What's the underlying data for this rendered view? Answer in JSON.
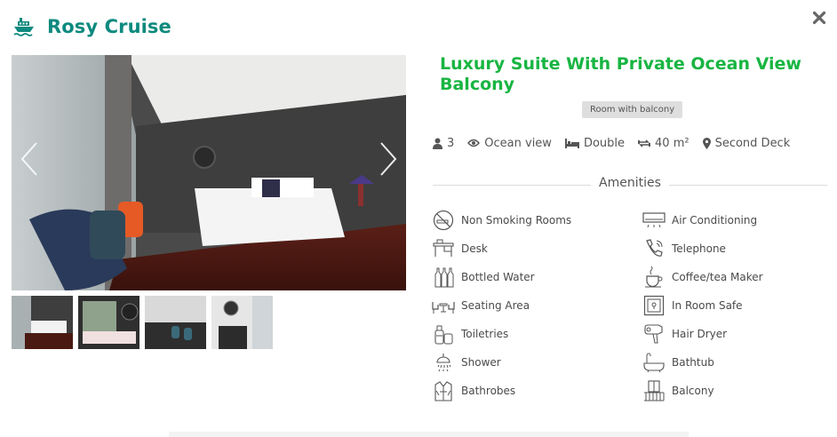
{
  "header": {
    "title": "Rosy Cruise",
    "logo_icon": "ship-icon"
  },
  "colors": {
    "brand": "#0d8a7e",
    "title": "#18b541",
    "text": "#4a4a4a"
  },
  "gallery": {
    "prev_icon": "chevron-left-icon",
    "next_icon": "chevron-right-icon",
    "thumbnails": [
      "thumb-1",
      "thumb-2",
      "thumb-3",
      "thumb-4"
    ]
  },
  "room": {
    "title": "Luxury Suite With Private Ocean View Balcony",
    "badge": "Room with balcony",
    "specs": [
      {
        "icon": "user-icon",
        "label": "3"
      },
      {
        "icon": "eye-icon",
        "label": "Ocean view"
      },
      {
        "icon": "bed-icon",
        "label": "Double"
      },
      {
        "icon": "area-icon",
        "label": "40 m²"
      },
      {
        "icon": "map-marker-icon",
        "label": "Second Deck"
      }
    ]
  },
  "amenities": {
    "title": "Amenities",
    "items": [
      {
        "label": "Non Smoking Rooms",
        "icon": "no-smoking-icon"
      },
      {
        "label": "Air Conditioning",
        "icon": "air-conditioner-icon"
      },
      {
        "label": "Desk",
        "icon": "desk-icon"
      },
      {
        "label": "Telephone",
        "icon": "telephone-icon"
      },
      {
        "label": "Bottled Water",
        "icon": "bottled-water-icon"
      },
      {
        "label": "Coffee/tea Maker",
        "icon": "coffee-maker-icon"
      },
      {
        "label": "Seating Area",
        "icon": "seating-area-icon"
      },
      {
        "label": "In Room Safe",
        "icon": "safe-icon"
      },
      {
        "label": "Toiletries",
        "icon": "toiletries-icon"
      },
      {
        "label": "Hair Dryer",
        "icon": "hair-dryer-icon"
      },
      {
        "label": "Shower",
        "icon": "shower-icon"
      },
      {
        "label": "Bathtub",
        "icon": "bathtub-icon"
      },
      {
        "label": "Bathrobes",
        "icon": "bathrobe-icon"
      },
      {
        "label": "Balcony",
        "icon": "balcony-icon"
      }
    ]
  }
}
